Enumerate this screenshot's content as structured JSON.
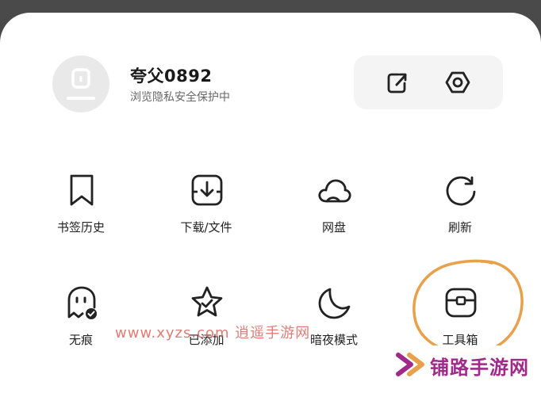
{
  "profile": {
    "name": "夸父0892",
    "subtitle": "浏览隐私安全保护中"
  },
  "header_actions": [
    {
      "icon": "share-out-icon"
    },
    {
      "icon": "settings-hexagon-icon"
    }
  ],
  "menu": {
    "row1": [
      {
        "label": "书签历史",
        "icon": "bookmark-icon"
      },
      {
        "label": "下载/文件",
        "icon": "download-icon"
      },
      {
        "label": "网盘",
        "icon": "cloud-icon"
      },
      {
        "label": "刷新",
        "icon": "refresh-icon"
      }
    ],
    "row2": [
      {
        "label": "无痕",
        "icon": "ghost-incognito-icon"
      },
      {
        "label": "已添加",
        "icon": "star-check-icon"
      },
      {
        "label": "暗夜模式",
        "icon": "moon-icon"
      },
      {
        "label": "工具箱",
        "icon": "toolbox-icon"
      }
    ]
  },
  "watermark": {
    "text": "www.xyzs.com 逍遥手游网"
  },
  "corner_logo": {
    "text": "铺路手游网"
  },
  "colors": {
    "highlight_circle": "#e8a04a",
    "watermark": "#d9675f",
    "logo": "#a02a8a"
  }
}
